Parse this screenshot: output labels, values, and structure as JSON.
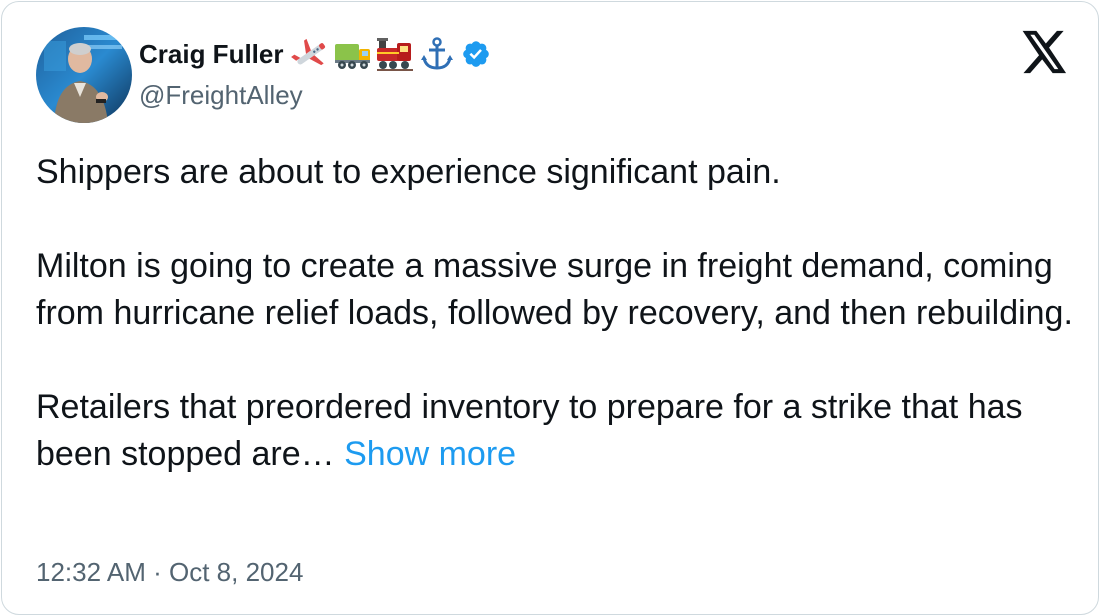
{
  "tweet": {
    "author": {
      "display_name": "Craig Fuller",
      "name_emojis": [
        "airplane-emoji",
        "truck-emoji",
        "locomotive-emoji",
        "anchor-emoji"
      ],
      "verified": true,
      "handle": "@FreightAlley"
    },
    "paragraphs": [
      "Shippers are about to experience significant pain.",
      "Milton is going to create a massive surge in freight demand, coming from hurricane relief loads, followed by recovery, and then rebuilding.",
      "Retailers that preordered inventory to prepare for a strike that has been stopped are… "
    ],
    "show_more_label": "Show more",
    "time": "12:32 AM",
    "separator": "·",
    "date": "Oct 8, 2024",
    "brand_logo": "x-logo-icon"
  },
  "colors": {
    "text_primary": "#0f1419",
    "text_secondary": "#536471",
    "link": "#1d9bf0",
    "verified_badge": "#1d9bf0",
    "border": "#cfd9de"
  }
}
